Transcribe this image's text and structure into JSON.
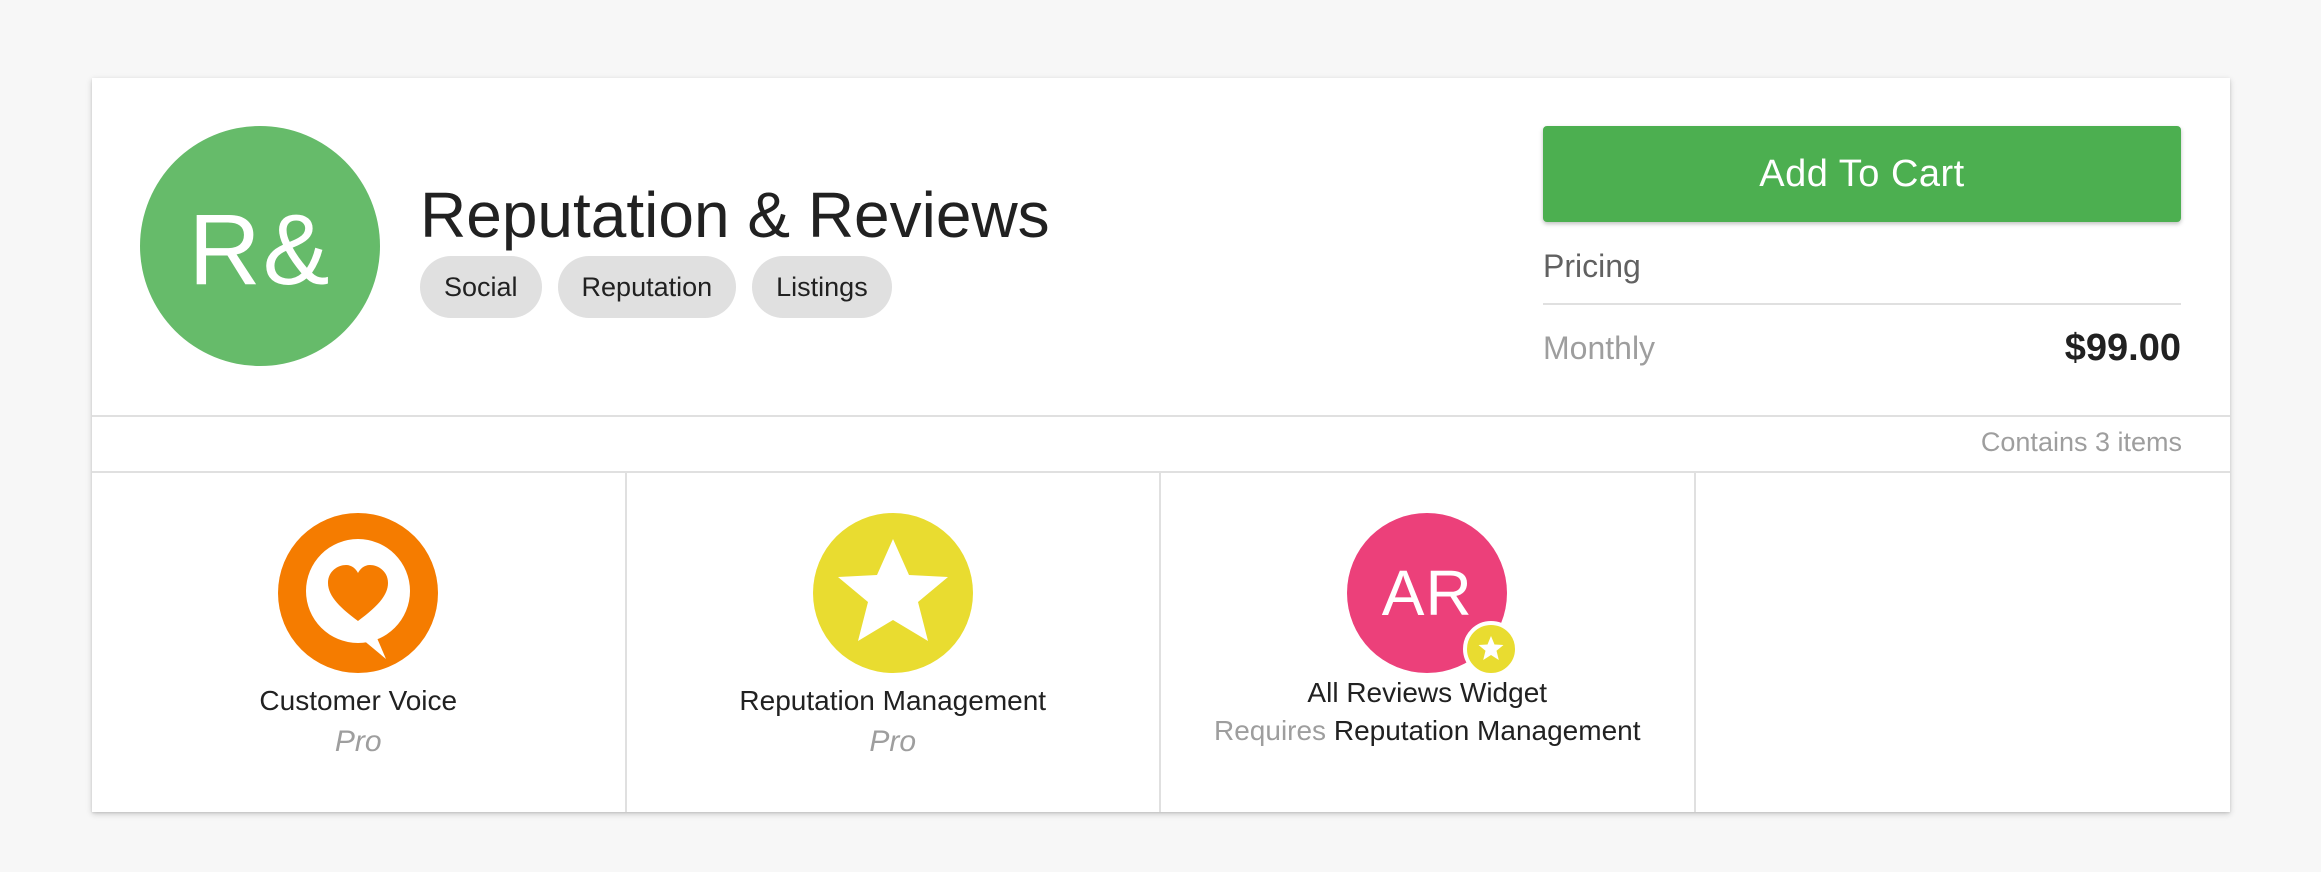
{
  "product": {
    "logo_text": "R&",
    "logo_color": "#66bb6a",
    "title": "Reputation & Reviews",
    "tags": [
      "Social",
      "Reputation",
      "Listings"
    ]
  },
  "purchase": {
    "add_to_cart_label": "Add To Cart",
    "button_color": "#4caf50",
    "pricing_label": "Pricing",
    "period": "Monthly",
    "price": "$99.00"
  },
  "contents": {
    "summary": "Contains 3 items"
  },
  "items": [
    {
      "name": "Customer Voice",
      "edition": "Pro",
      "icon": "speech-bubble-heart-icon",
      "color": "#f57c00"
    },
    {
      "name": "Reputation Management",
      "edition": "Pro",
      "icon": "star-icon",
      "color": "#e9dc30"
    },
    {
      "name": "All Reviews Widget",
      "icon_text": "AR",
      "color": "#ec407a",
      "badge_icon": "star-badge-icon",
      "requires_label": "Requires",
      "requires_name": "Reputation Management"
    }
  ]
}
